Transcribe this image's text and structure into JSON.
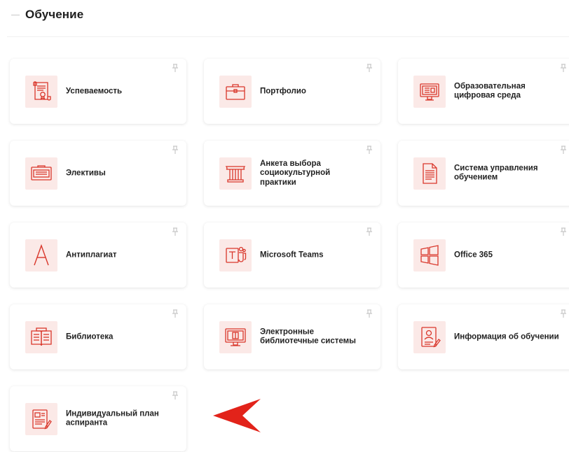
{
  "section": {
    "title": "Обучение"
  },
  "colors": {
    "accent": "#d9372b",
    "icon_bg": "#fbe9e7",
    "pin": "#c8c8c8"
  },
  "cards": [
    {
      "label": "Успеваемость",
      "icon": "scroll-certificate-icon"
    },
    {
      "label": "Портфолио",
      "icon": "briefcase-icon"
    },
    {
      "label": "Образовательная\nцифровая среда",
      "icon": "monitor-icon"
    },
    {
      "label": "Элективы",
      "icon": "tray-icon"
    },
    {
      "label": "Анкета выбора\nсоциокультурной\nпрактики",
      "icon": "column-icon"
    },
    {
      "label": "Система управления\nобучением",
      "icon": "document-icon"
    },
    {
      "label": "Антиплагиат",
      "icon": "letter-a-icon"
    },
    {
      "label": "Microsoft Teams",
      "icon": "teams-icon"
    },
    {
      "label": "Office 365",
      "icon": "windows-icon"
    },
    {
      "label": "Библиотека",
      "icon": "open-book-icon"
    },
    {
      "label": "Электронные\nбиблиотечные системы",
      "icon": "screen-book-icon"
    },
    {
      "label": "Информация об обучении",
      "icon": "id-card-icon"
    },
    {
      "label": "Индивидуальный план\nаспиранта",
      "icon": "plan-document-icon"
    }
  ]
}
